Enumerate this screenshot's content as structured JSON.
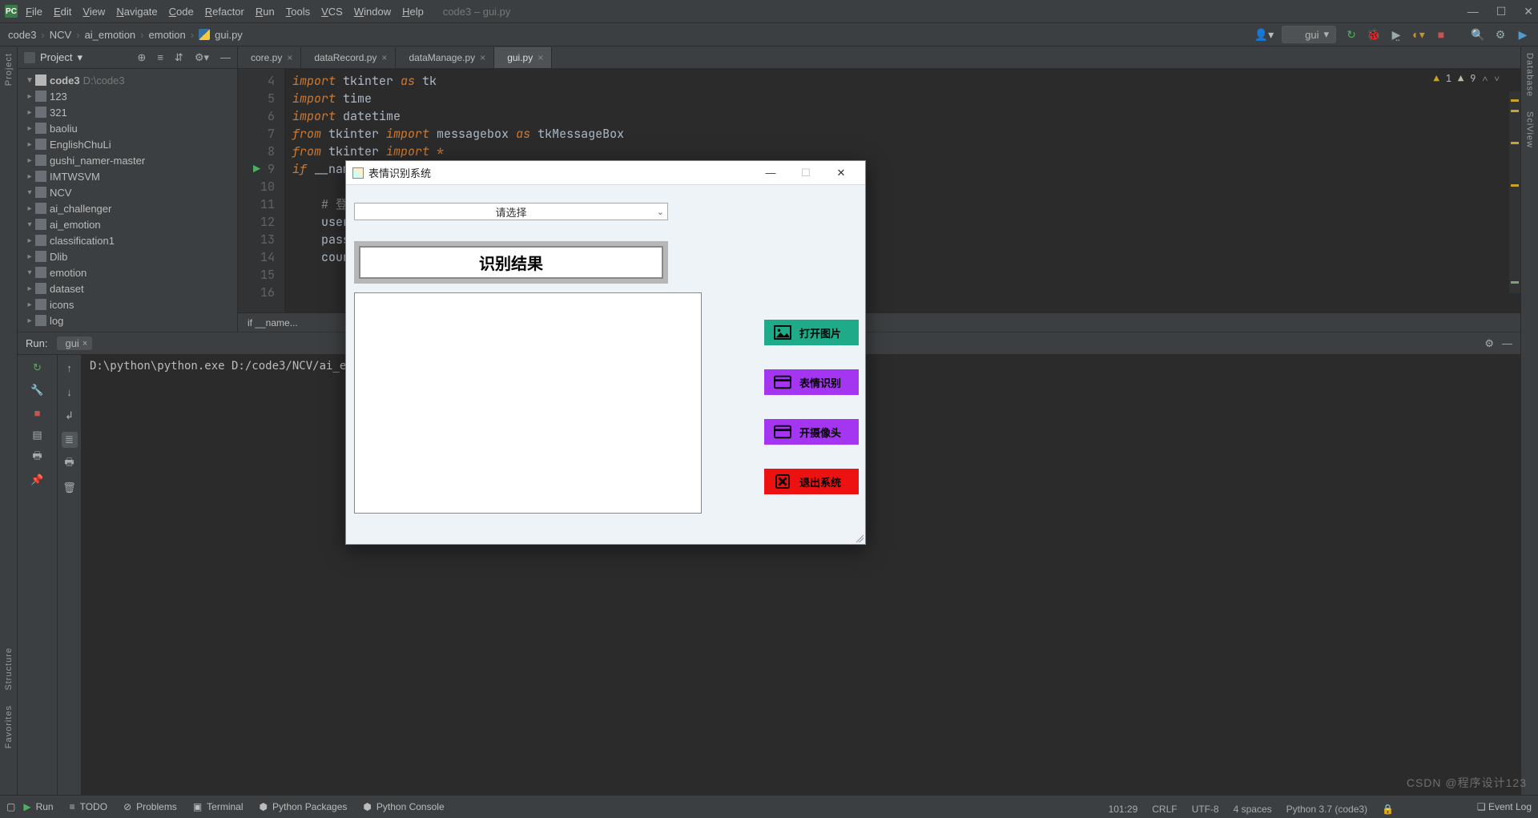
{
  "window": {
    "title_project": "code3",
    "title_file": "gui.py",
    "menu": [
      "File",
      "Edit",
      "View",
      "Navigate",
      "Code",
      "Refactor",
      "Run",
      "Tools",
      "VCS",
      "Window",
      "Help"
    ]
  },
  "breadcrumbs": [
    "code3",
    "NCV",
    "ai_emotion",
    "emotion",
    "gui.py"
  ],
  "run_config": "gui",
  "inspections": {
    "errors": "1",
    "warnings": "9"
  },
  "project": {
    "pane_label": "Project",
    "root_name": "code3",
    "root_path": "D:\\code3",
    "nodes": [
      {
        "name": "123",
        "depth": 1,
        "expand": "▶"
      },
      {
        "name": "321",
        "depth": 1,
        "expand": "▶"
      },
      {
        "name": "baoliu",
        "depth": 1,
        "expand": "▶"
      },
      {
        "name": "EnglishChuLi",
        "depth": 1,
        "expand": "▶"
      },
      {
        "name": "gushi_namer-master",
        "depth": 1,
        "expand": "▶"
      },
      {
        "name": "IMTWSVM",
        "depth": 1,
        "expand": "▶"
      },
      {
        "name": "NCV",
        "depth": 1,
        "expand": "▼"
      },
      {
        "name": "ai_challenger",
        "depth": 2,
        "expand": "▶"
      },
      {
        "name": "ai_emotion",
        "depth": 2,
        "expand": "▼"
      },
      {
        "name": "classification1",
        "depth": 3,
        "expand": "▶"
      },
      {
        "name": "Dlib",
        "depth": 3,
        "expand": "▶"
      },
      {
        "name": "emotion",
        "depth": 3,
        "expand": "▼"
      },
      {
        "name": "dataset",
        "depth": 4,
        "expand": "▶"
      },
      {
        "name": "icons",
        "depth": 4,
        "expand": "▶"
      },
      {
        "name": "log",
        "depth": 4,
        "expand": "▶"
      }
    ]
  },
  "tabs": [
    {
      "label": "core.py",
      "active": false
    },
    {
      "label": "dataRecord.py",
      "active": false
    },
    {
      "label": "dataManage.py",
      "active": false
    },
    {
      "label": "gui.py",
      "active": true
    }
  ],
  "editor": {
    "lines": [
      {
        "n": 4,
        "html": "<span class='kw'>import</span> tkinter <span class='kw'>as</span> tk"
      },
      {
        "n": 5,
        "html": "<span class='kw'>import</span> time"
      },
      {
        "n": 6,
        "html": "<span class='kw'>import</span> datetime"
      },
      {
        "n": 7,
        "html": "<span class='kw'>from</span> tkinter <span class='kw'>import</span> messagebox <span class='kw'>as</span> tkMessageBox"
      },
      {
        "n": 8,
        "html": "<span class='kw'>from</span> tkinter <span class='kw'>import</span> <span class='op'>*</span>"
      },
      {
        "n": 9,
        "html": "<span class='kw'>if</span> __nam"
      },
      {
        "n": 10,
        "html": ""
      },
      {
        "n": 11,
        "html": "&nbsp;&nbsp;&nbsp;&nbsp;<span class='cm'># 登</span>"
      },
      {
        "n": 12,
        "html": "&nbsp;&nbsp;&nbsp;&nbsp;user"
      },
      {
        "n": 13,
        "html": "&nbsp;&nbsp;&nbsp;&nbsp;pass"
      },
      {
        "n": 14,
        "html": "&nbsp;&nbsp;&nbsp;&nbsp;coun"
      },
      {
        "n": 15,
        "html": ""
      },
      {
        "n": 16,
        "html": ""
      }
    ],
    "run_caret_line": 9,
    "bottom_crumb": "if __name..."
  },
  "run": {
    "title": "Run:",
    "config_name": "gui",
    "console_text": "D:\\python\\python.exe D:/code3/NCV/ai_emotion"
  },
  "statusbar": {
    "tools": [
      "Run",
      "TODO",
      "Problems",
      "Terminal",
      "Python Packages",
      "Python Console"
    ],
    "event_log": "Event Log",
    "right": [
      "101:29",
      "CRLF",
      "UTF-8",
      "4 spaces",
      "Python 3.7 (code3)"
    ]
  },
  "left_rail": [
    "Project",
    "Structure",
    "Favorites"
  ],
  "right_rail": [
    "Database",
    "SciView"
  ],
  "dialog": {
    "title": "表情识别系统",
    "combo_placeholder": "请选择",
    "result_label": "识别结果",
    "buttons": {
      "open_image": "打开图片",
      "recognize": "表情识别",
      "camera": "开摄像头",
      "exit": "退出系统"
    }
  },
  "watermark": "CSDN @程序设计123"
}
